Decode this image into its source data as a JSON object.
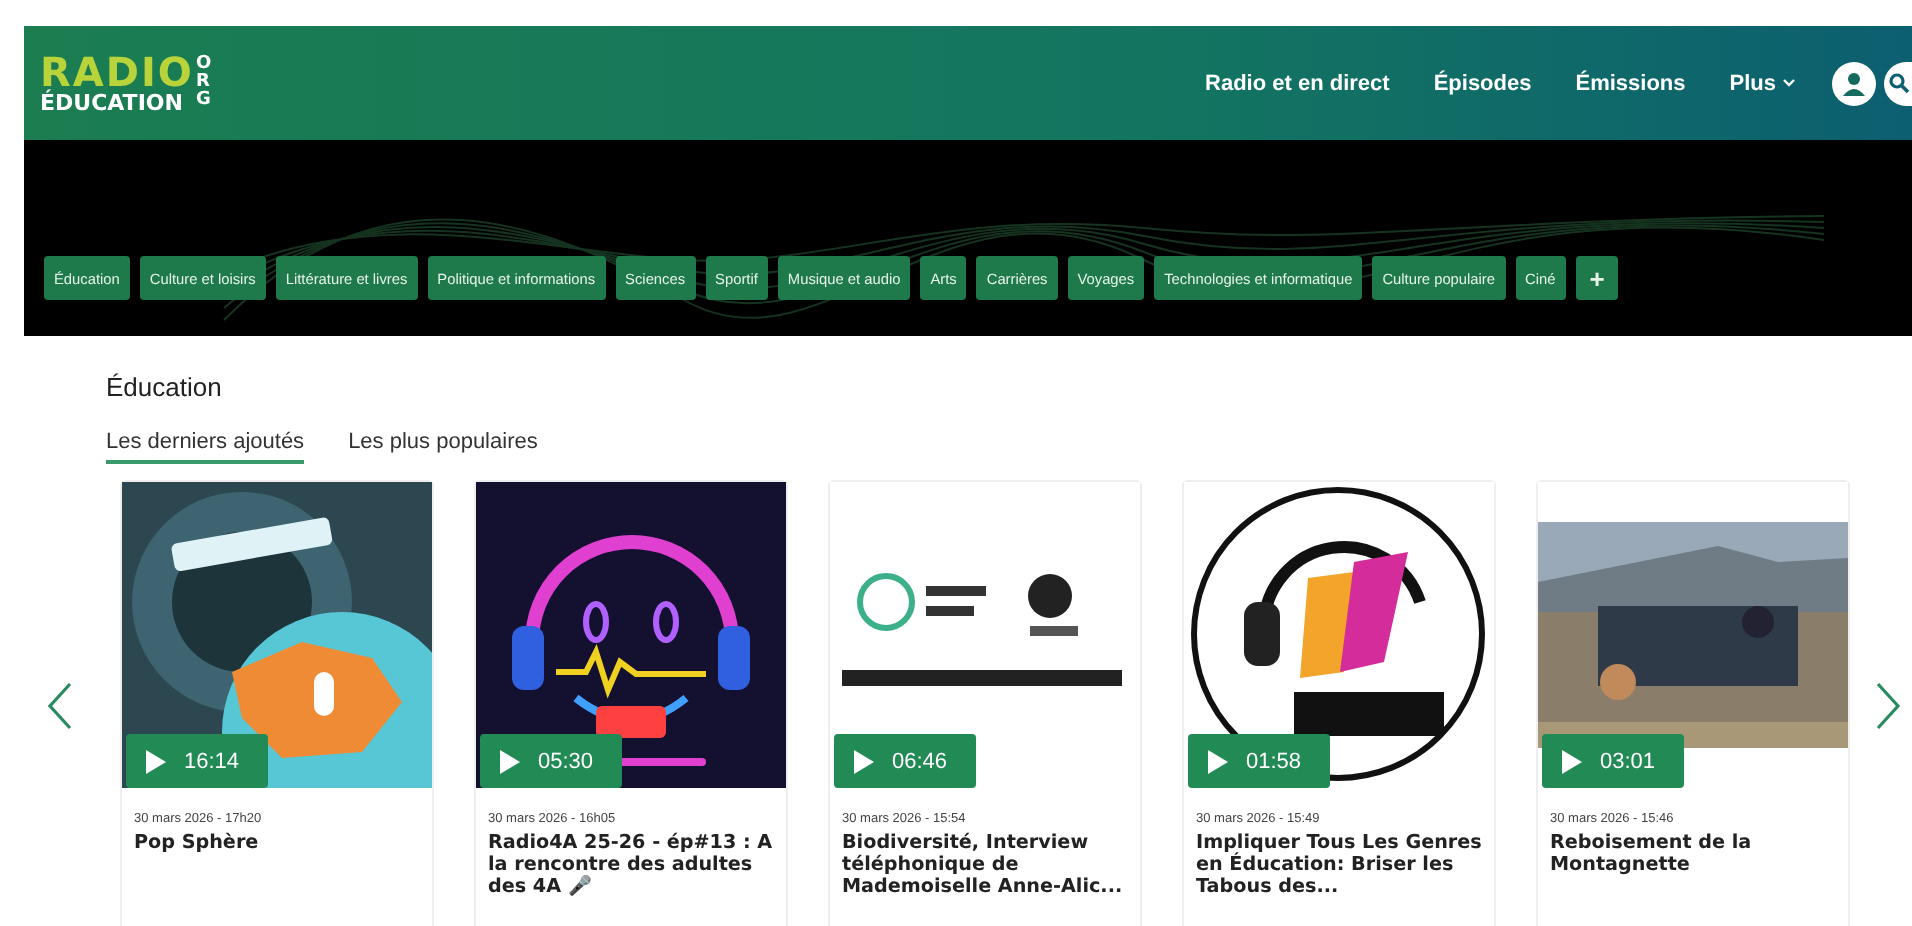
{
  "header": {
    "logo_top": "RADIO",
    "logo_bottom": "ÉDUCATION",
    "logo_side": "ORG",
    "nav": [
      "Radio et en direct",
      "Épisodes",
      "Émissions"
    ],
    "more": "Plus"
  },
  "categories": [
    "Éducation",
    "Culture et loisirs",
    "Littérature et livres",
    "Politique et informations",
    "Sciences",
    "Sportif",
    "Musique et audio",
    "Arts",
    "Carrières",
    "Voyages",
    "Technologies et informatique",
    "Culture populaire",
    "Ciné"
  ],
  "add_button": "+",
  "section": {
    "title": "Éducation",
    "tabs": [
      {
        "label": "Les derniers ajoutés",
        "selected": true
      },
      {
        "label": "Les plus populaires",
        "selected": false
      }
    ]
  },
  "episodes": [
    {
      "duration": "16:14",
      "date": "30 mars 2026 - 17h20",
      "title": "Pop Sphère"
    },
    {
      "duration": "05:30",
      "date": "30 mars 2026 - 16h05",
      "title": "Radio4A 25-26 - ép#13 : A la rencontre des adultes des 4A 🎤"
    },
    {
      "duration": "06:46",
      "date": "30 mars 2026 - 15:54",
      "title": "Biodiversité, Interview téléphonique de Mademoiselle Anne-Alic..."
    },
    {
      "duration": "01:58",
      "date": "30 mars 2026 - 15:49",
      "title": "Impliquer Tous Les Genres en Éducation: Briser les Tabous des..."
    },
    {
      "duration": "03:01",
      "date": "30 mars 2026 - 15:46",
      "title": "Reboisement de la Montagnette"
    }
  ]
}
